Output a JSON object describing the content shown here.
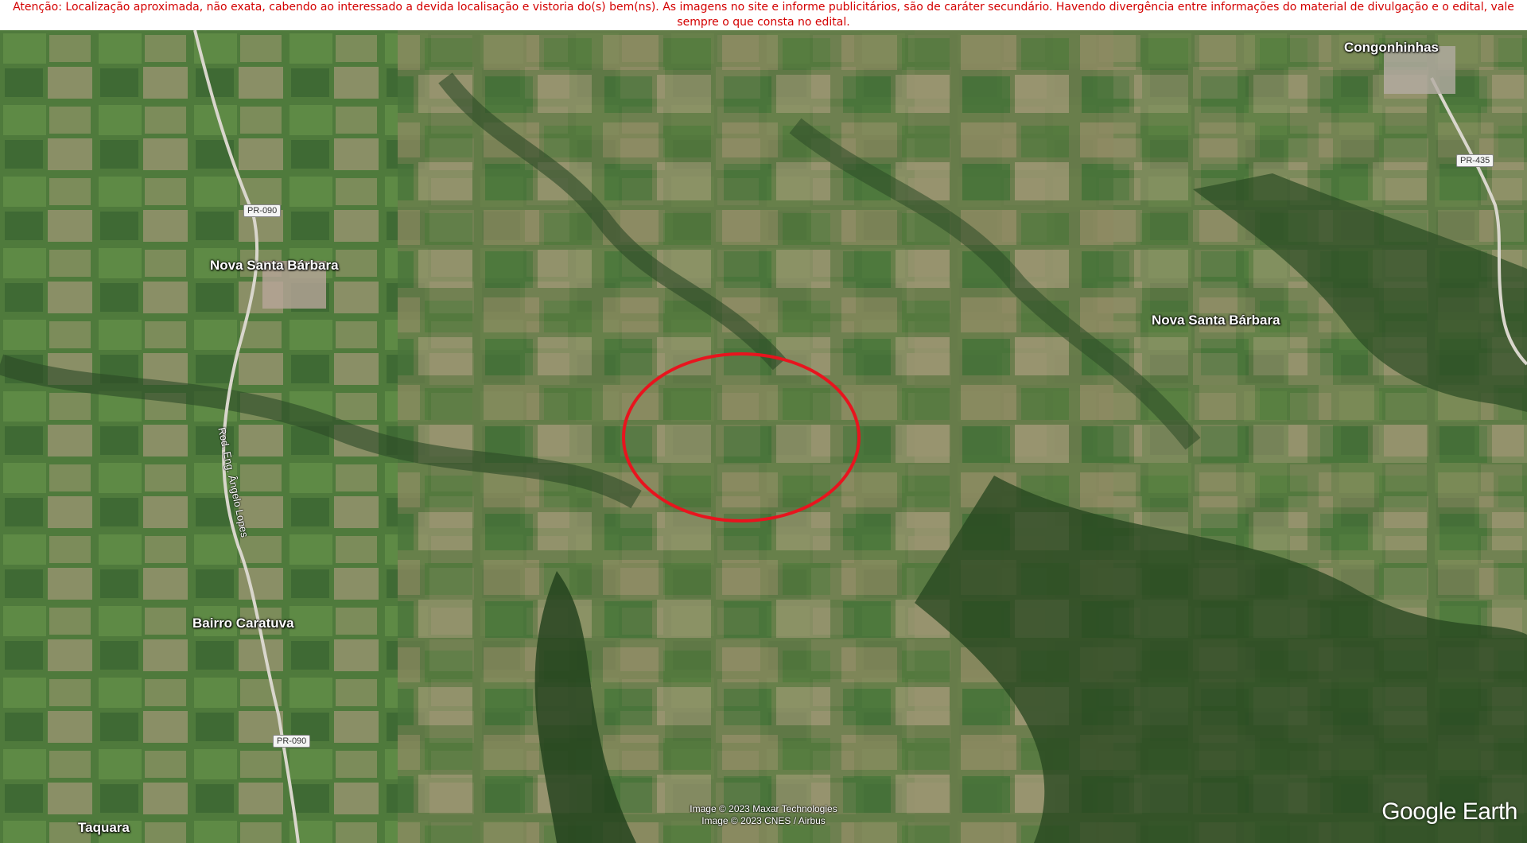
{
  "notice": {
    "text": "Atenção: Localização aproximada, não exata, cabendo ao interessado a devida localisação e vistoria do(s) bem(ns). As imagens no site e informe publicitários, são de caráter secundário. Havendo divergência entre informações do material de divulgação e o edital, vale sempre o que consta no edital.",
    "color": "#d40000"
  },
  "map": {
    "places": {
      "congonhinhas": "Congonhinhas",
      "nova_santa_barbara_west": "Nova Santa Bárbara",
      "nova_santa_barbara_east": "Nova Santa Bárbara",
      "bairro_caratuva": "Bairro Caratuva",
      "taquara": "Taquara"
    },
    "roads": {
      "pr090_north": "PR-090",
      "pr090_south": "PR-090",
      "pr435": "PR-435",
      "rod_name": "Rod. Eng. Ângelo Lopes"
    },
    "highlight": {
      "shape": "ellipse",
      "color": "#e8141e"
    },
    "attribution": {
      "line1": "Image © 2023 Maxar Technologies",
      "line2": "Image © 2023 CNES / Airbus"
    },
    "brand": "Google Earth"
  }
}
